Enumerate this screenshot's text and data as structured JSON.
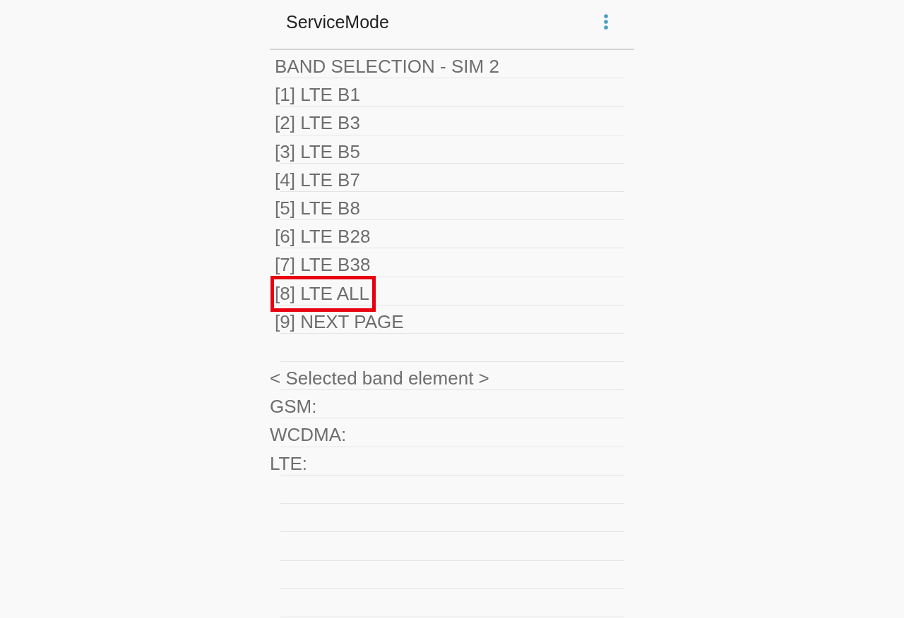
{
  "app_bar": {
    "title": "ServiceMode"
  },
  "band_selection": {
    "heading": "BAND SELECTION - SIM 2",
    "options": [
      {
        "label": "[1] LTE B1",
        "highlighted": false
      },
      {
        "label": "[2] LTE B3",
        "highlighted": false
      },
      {
        "label": "[3] LTE B5",
        "highlighted": false
      },
      {
        "label": "[4] LTE B7",
        "highlighted": false
      },
      {
        "label": "[5] LTE B8",
        "highlighted": false
      },
      {
        "label": "[6] LTE B28",
        "highlighted": false
      },
      {
        "label": "[7] LTE B38",
        "highlighted": false
      },
      {
        "label": "[8] LTE ALL",
        "highlighted": true
      },
      {
        "label": "[9] NEXT PAGE",
        "highlighted": false
      }
    ]
  },
  "selected_band_element": {
    "heading": "< Selected band element >",
    "lines": [
      "GSM:",
      "WCDMA:",
      "LTE:"
    ]
  }
}
